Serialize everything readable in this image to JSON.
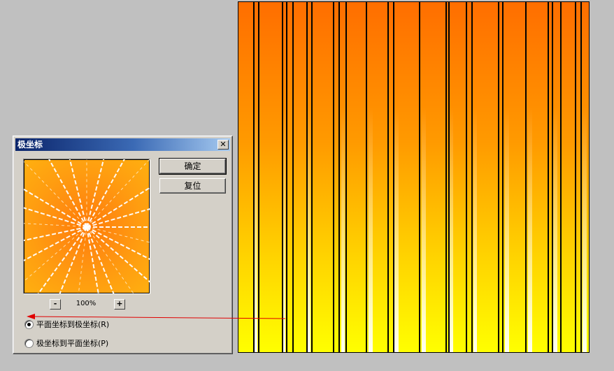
{
  "dialog": {
    "title": "极坐标",
    "close_glyph": "✕",
    "ok_label": "确定",
    "reset_label": "复位",
    "zoom_minus": "-",
    "zoom_plus": "+",
    "zoom_value": "100%",
    "options": [
      {
        "label": "平面坐标到极坐标(R)",
        "checked": true
      },
      {
        "label": "极坐标到平面坐标(P)",
        "checked": false
      }
    ]
  },
  "annotation": {
    "color": "#e00000"
  },
  "icons": {
    "close": "close-icon",
    "arrow": "arrow-left-icon"
  }
}
